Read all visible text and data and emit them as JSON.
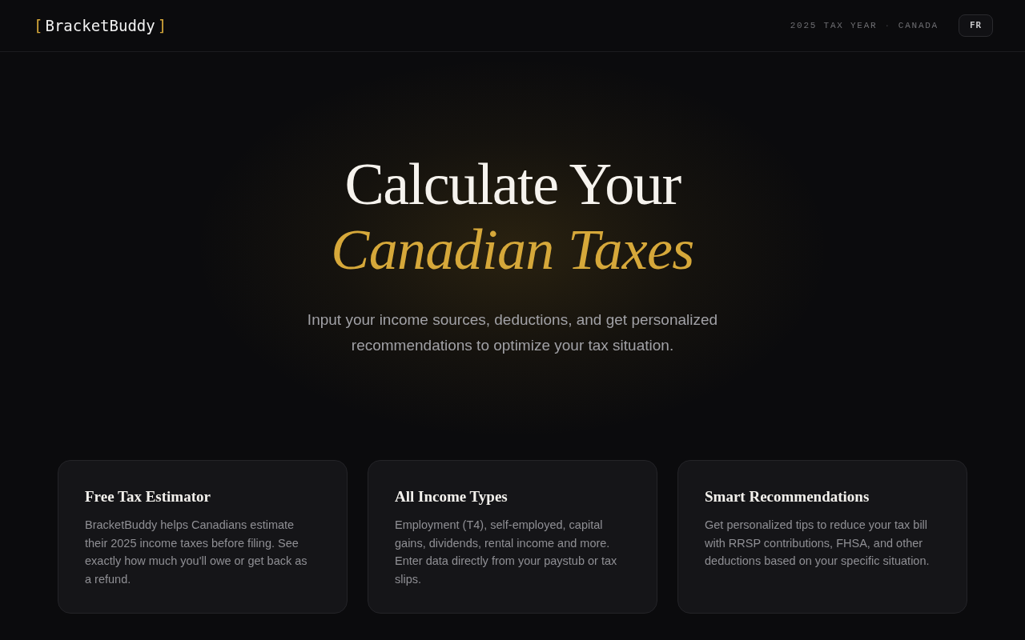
{
  "header": {
    "brand": {
      "open_bracket": "[",
      "name": "BracketBuddy",
      "close_bracket": "]"
    },
    "meta": {
      "tax_year": "2025 TAX YEAR",
      "separator": "·",
      "country": "CANADA"
    },
    "language_button": "FR"
  },
  "hero": {
    "title_line_1": "Calculate Your",
    "title_line_2": "Canadian Taxes",
    "subtitle": "Input your income sources, deductions, and get personalized recommendations to optimize your tax situation."
  },
  "features": [
    {
      "title": "Free Tax Estimator",
      "description": "BracketBuddy helps Canadians estimate their 2025 income taxes before filing. See exactly how much you'll owe or get back as a refund."
    },
    {
      "title": "All Income Types",
      "description": "Employment (T4), self-employed, capital gains, dividends, rental income and more. Enter data directly from your paystub or tax slips."
    },
    {
      "title": "Smart Recommendations",
      "description": "Get personalized tips to reduce your tax bill with RRSP contributions, FHSA, and other deductions based on your specific situation."
    }
  ]
}
